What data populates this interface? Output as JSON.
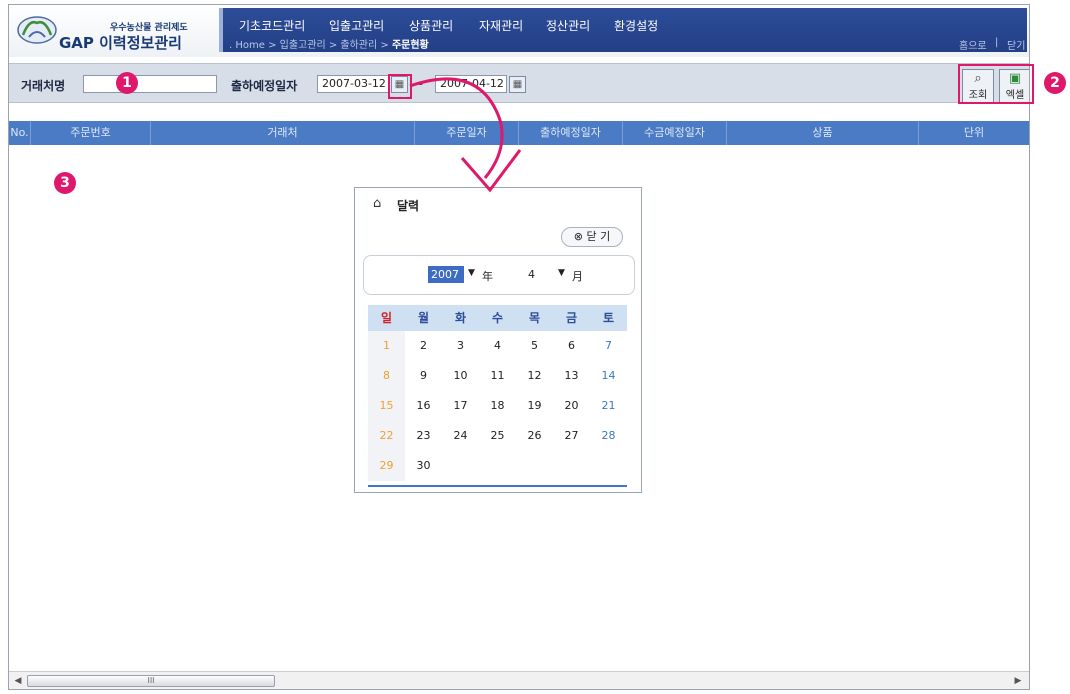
{
  "header": {
    "logo_sub": "우수농산물 관리제도",
    "logo_main": "GAP 이력정보관리",
    "menu": [
      "기초코드관리",
      "입출고관리",
      "상품관리",
      "자재관리",
      "정산관리",
      "환경설정"
    ],
    "breadcrumb": [
      ". Home",
      "입출고관리",
      "출하관리",
      "주문현황"
    ],
    "links": [
      "홈으로",
      "닫기"
    ]
  },
  "search": {
    "partner_label": "거래처명",
    "partner_value": "",
    "date_label": "출하예정일자",
    "date_from": "2007-03-12",
    "date_sep": "~",
    "date_to": "2007-04-12",
    "search_label": "조회",
    "excel_label": "엑셀"
  },
  "grid": {
    "columns": [
      "No.",
      "주문번호",
      "거래처",
      "주문일자",
      "출하예정일자",
      "수금예정일자",
      "상품",
      "단위"
    ]
  },
  "scrollbar": {
    "thumb_label": "III"
  },
  "calendar": {
    "title": "달력",
    "close_label": "닫 기",
    "year": "2007",
    "year_unit": "年",
    "month": "4",
    "month_unit": "月",
    "weekdays": [
      "일",
      "월",
      "화",
      "수",
      "목",
      "금",
      "토"
    ],
    "weeks": [
      [
        "1",
        "2",
        "3",
        "4",
        "5",
        "6",
        "7"
      ],
      [
        "8",
        "9",
        "10",
        "11",
        "12",
        "13",
        "14"
      ],
      [
        "15",
        "16",
        "17",
        "18",
        "19",
        "20",
        "21"
      ],
      [
        "22",
        "23",
        "24",
        "25",
        "26",
        "27",
        "28"
      ],
      [
        "29",
        "30",
        "",
        "",
        "",
        "",
        ""
      ]
    ]
  },
  "annotations": [
    "1",
    "2",
    "3"
  ],
  "colors": {
    "accent": "#e0186c",
    "nav": "#2d4d99",
    "grid_header": "#4a7bc4"
  }
}
